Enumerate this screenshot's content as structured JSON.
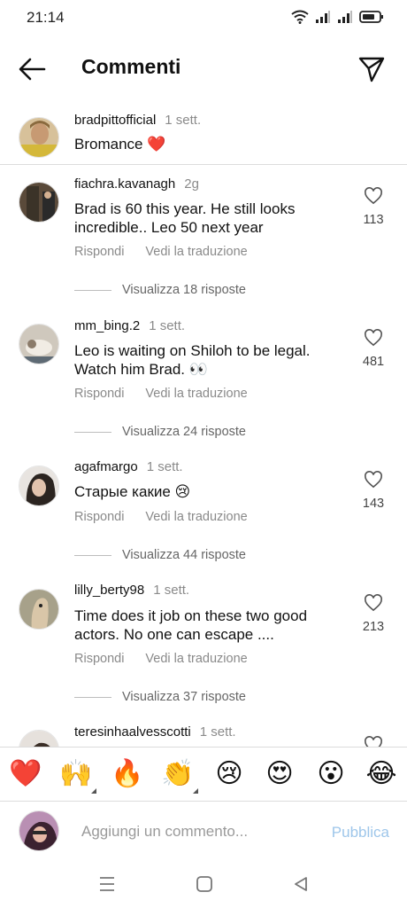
{
  "status_bar": {
    "time": "21:14"
  },
  "header": {
    "title": "Commenti"
  },
  "caption": {
    "username": "bradpittofficial",
    "time": "1 sett.",
    "text": "Bromance ❤️"
  },
  "comments": [
    {
      "username": "fiachra.kavanagh",
      "time": "2g",
      "lines": [
        "Brad is 60 this year. He still looks",
        "incredible.. Leo 50 next year"
      ],
      "likes": "113",
      "reply": "Rispondi",
      "translate": "Vedi la traduzione",
      "view_replies": "Visualizza 18 risposte"
    },
    {
      "username": "mm_bing.2",
      "time": "1 sett.",
      "lines": [
        "Leo is waiting on Shiloh to be legal.",
        "Watch him Brad. 👀"
      ],
      "likes": "481",
      "reply": "Rispondi",
      "translate": "Vedi la traduzione",
      "view_replies": "Visualizza 24 risposte"
    },
    {
      "username": "agafmargo",
      "time": "1 sett.",
      "lines": [
        "Старые какие 😢"
      ],
      "likes": "143",
      "reply": "Rispondi",
      "translate": "Vedi la traduzione",
      "view_replies": "Visualizza 44 risposte"
    },
    {
      "username": "lilly_berty98",
      "time": "1 sett.",
      "lines": [
        "Time does it job on these two good",
        "actors. No one can escape ...."
      ],
      "likes": "213",
      "reply": "Rispondi",
      "translate": "Vedi la traduzione",
      "view_replies": "Visualizza 37 risposte"
    },
    {
      "username": "teresinhaalvesscotti",
      "time": "1 sett."
    }
  ],
  "emoji_bar": [
    "❤️",
    "🙌",
    "🔥",
    "👏",
    "😢",
    "😍",
    "😮",
    "😂"
  ],
  "comment_input": {
    "placeholder": "Aggiungi un commento...",
    "post_label": "Pubblica"
  },
  "colors": {
    "like_heart": "#ed4956",
    "post_disabled": "#9ec6ea",
    "secondary_text": "#8a8a8a"
  },
  "icons": [
    "back-arrow-icon",
    "send-icon",
    "heart-outline-icon",
    "wifi-icon",
    "signal-icon",
    "battery-icon",
    "menu-nav-icon",
    "home-nav-icon",
    "back-nav-icon"
  ]
}
